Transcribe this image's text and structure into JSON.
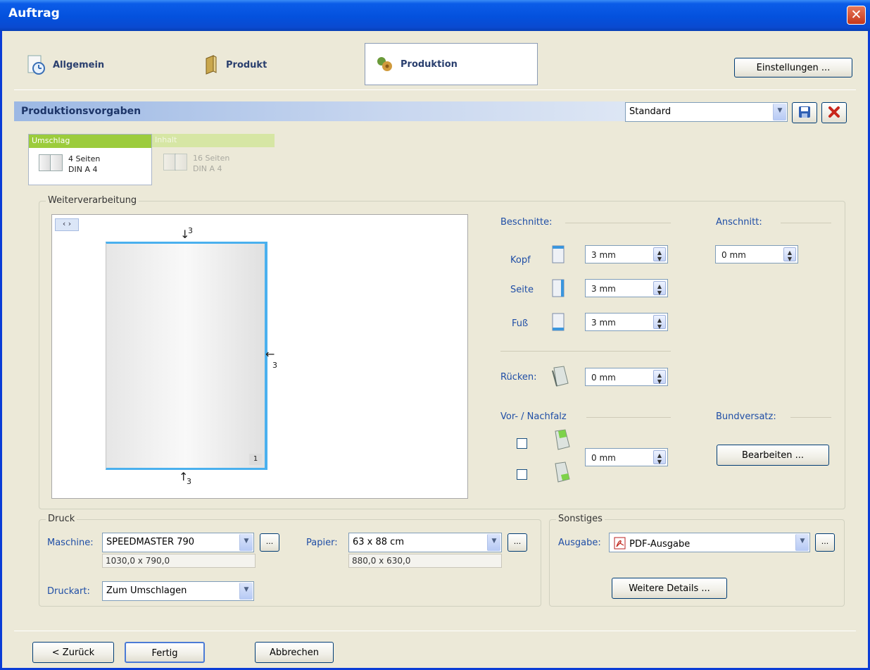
{
  "window": {
    "title": "Auftrag",
    "close_icon": "close-icon"
  },
  "tabs": [
    {
      "label": "Allgemein",
      "icon": "clock-document-icon"
    },
    {
      "label": "Produkt",
      "icon": "book-icon"
    },
    {
      "label": "Produktion",
      "icon": "production-icon"
    }
  ],
  "settings_button": "Einstellungen ...",
  "section": {
    "title": "Produktionsvorgaben",
    "preset": "Standard"
  },
  "parts": [
    {
      "header": "Umschlag",
      "pages": "4 Seiten",
      "format": "DIN A 4",
      "active": true
    },
    {
      "header": "Inhalt",
      "pages": "16 Seiten",
      "format": "DIN A 4",
      "active": false
    }
  ],
  "weiterverarbeitung": {
    "title": "Weiterverarbeitung",
    "preview": {
      "nav": "‹ ›",
      "top": "3",
      "right": "3",
      "bottom": "3",
      "page_number": "1"
    },
    "beschnitte_label": "Beschnitte:",
    "anschnitt_label": "Anschnitt:",
    "anschnitt_value": "0 mm",
    "kopf_label": "Kopf",
    "kopf_value": "3 mm",
    "seite_label": "Seite",
    "seite_value": "3 mm",
    "fuss_label": "Fuß",
    "fuss_value": "3 mm",
    "ruecken_label": "Rücken:",
    "ruecken_value": "0 mm",
    "falz_label": "Vor- / Nachfalz",
    "falz_value": "0 mm",
    "bundversatz_label": "Bundversatz:",
    "bearbeiten_button": "Bearbeiten ..."
  },
  "druck": {
    "title": "Druck",
    "maschine_label": "Maschine:",
    "maschine_value": "SPEEDMASTER 790",
    "maschine_size": "1030,0 x 790,0",
    "papier_label": "Papier:",
    "papier_value": "63 x 88 cm",
    "papier_size": "880,0 x 630,0",
    "druckart_label": "Druckart:",
    "druckart_value": "Zum Umschlagen",
    "more_button": "..."
  },
  "sonstiges": {
    "title": "Sonstiges",
    "ausgabe_label": "Ausgabe:",
    "ausgabe_value": "PDF-Ausgabe",
    "details_button": "Weitere Details ..."
  },
  "footer": {
    "back": "< Zurück",
    "finish": "Fertig",
    "cancel": "Abbrechen"
  }
}
